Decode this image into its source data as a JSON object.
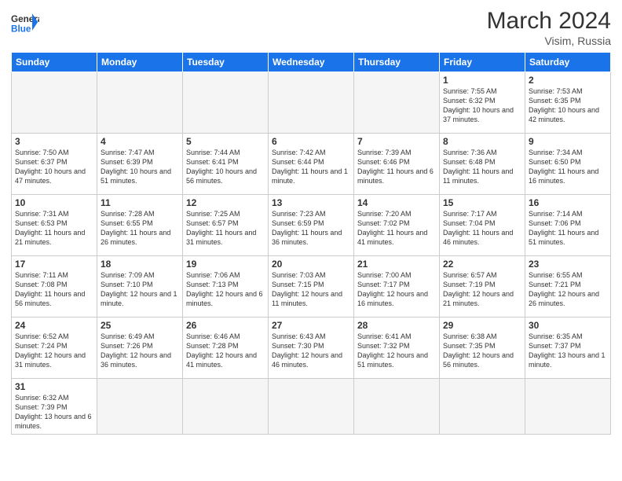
{
  "header": {
    "logo_general": "General",
    "logo_blue": "Blue",
    "month_year": "March 2024",
    "location": "Visim, Russia"
  },
  "weekdays": [
    "Sunday",
    "Monday",
    "Tuesday",
    "Wednesday",
    "Thursday",
    "Friday",
    "Saturday"
  ],
  "days": {
    "1": {
      "sunrise": "7:55 AM",
      "sunset": "6:32 PM",
      "daylight": "10 hours and 37 minutes."
    },
    "2": {
      "sunrise": "7:53 AM",
      "sunset": "6:35 PM",
      "daylight": "10 hours and 42 minutes."
    },
    "3": {
      "sunrise": "7:50 AM",
      "sunset": "6:37 PM",
      "daylight": "10 hours and 47 minutes."
    },
    "4": {
      "sunrise": "7:47 AM",
      "sunset": "6:39 PM",
      "daylight": "10 hours and 51 minutes."
    },
    "5": {
      "sunrise": "7:44 AM",
      "sunset": "6:41 PM",
      "daylight": "10 hours and 56 minutes."
    },
    "6": {
      "sunrise": "7:42 AM",
      "sunset": "6:44 PM",
      "daylight": "11 hours and 1 minute."
    },
    "7": {
      "sunrise": "7:39 AM",
      "sunset": "6:46 PM",
      "daylight": "11 hours and 6 minutes."
    },
    "8": {
      "sunrise": "7:36 AM",
      "sunset": "6:48 PM",
      "daylight": "11 hours and 11 minutes."
    },
    "9": {
      "sunrise": "7:34 AM",
      "sunset": "6:50 PM",
      "daylight": "11 hours and 16 minutes."
    },
    "10": {
      "sunrise": "7:31 AM",
      "sunset": "6:53 PM",
      "daylight": "11 hours and 21 minutes."
    },
    "11": {
      "sunrise": "7:28 AM",
      "sunset": "6:55 PM",
      "daylight": "11 hours and 26 minutes."
    },
    "12": {
      "sunrise": "7:25 AM",
      "sunset": "6:57 PM",
      "daylight": "11 hours and 31 minutes."
    },
    "13": {
      "sunrise": "7:23 AM",
      "sunset": "6:59 PM",
      "daylight": "11 hours and 36 minutes."
    },
    "14": {
      "sunrise": "7:20 AM",
      "sunset": "7:02 PM",
      "daylight": "11 hours and 41 minutes."
    },
    "15": {
      "sunrise": "7:17 AM",
      "sunset": "7:04 PM",
      "daylight": "11 hours and 46 minutes."
    },
    "16": {
      "sunrise": "7:14 AM",
      "sunset": "7:06 PM",
      "daylight": "11 hours and 51 minutes."
    },
    "17": {
      "sunrise": "7:11 AM",
      "sunset": "7:08 PM",
      "daylight": "11 hours and 56 minutes."
    },
    "18": {
      "sunrise": "7:09 AM",
      "sunset": "7:10 PM",
      "daylight": "12 hours and 1 minute."
    },
    "19": {
      "sunrise": "7:06 AM",
      "sunset": "7:13 PM",
      "daylight": "12 hours and 6 minutes."
    },
    "20": {
      "sunrise": "7:03 AM",
      "sunset": "7:15 PM",
      "daylight": "12 hours and 11 minutes."
    },
    "21": {
      "sunrise": "7:00 AM",
      "sunset": "7:17 PM",
      "daylight": "12 hours and 16 minutes."
    },
    "22": {
      "sunrise": "6:57 AM",
      "sunset": "7:19 PM",
      "daylight": "12 hours and 21 minutes."
    },
    "23": {
      "sunrise": "6:55 AM",
      "sunset": "7:21 PM",
      "daylight": "12 hours and 26 minutes."
    },
    "24": {
      "sunrise": "6:52 AM",
      "sunset": "7:24 PM",
      "daylight": "12 hours and 31 minutes."
    },
    "25": {
      "sunrise": "6:49 AM",
      "sunset": "7:26 PM",
      "daylight": "12 hours and 36 minutes."
    },
    "26": {
      "sunrise": "6:46 AM",
      "sunset": "7:28 PM",
      "daylight": "12 hours and 41 minutes."
    },
    "27": {
      "sunrise": "6:43 AM",
      "sunset": "7:30 PM",
      "daylight": "12 hours and 46 minutes."
    },
    "28": {
      "sunrise": "6:41 AM",
      "sunset": "7:32 PM",
      "daylight": "12 hours and 51 minutes."
    },
    "29": {
      "sunrise": "6:38 AM",
      "sunset": "7:35 PM",
      "daylight": "12 hours and 56 minutes."
    },
    "30": {
      "sunrise": "6:35 AM",
      "sunset": "7:37 PM",
      "daylight": "13 hours and 1 minute."
    },
    "31": {
      "sunrise": "6:32 AM",
      "sunset": "7:39 PM",
      "daylight": "13 hours and 6 minutes."
    }
  }
}
